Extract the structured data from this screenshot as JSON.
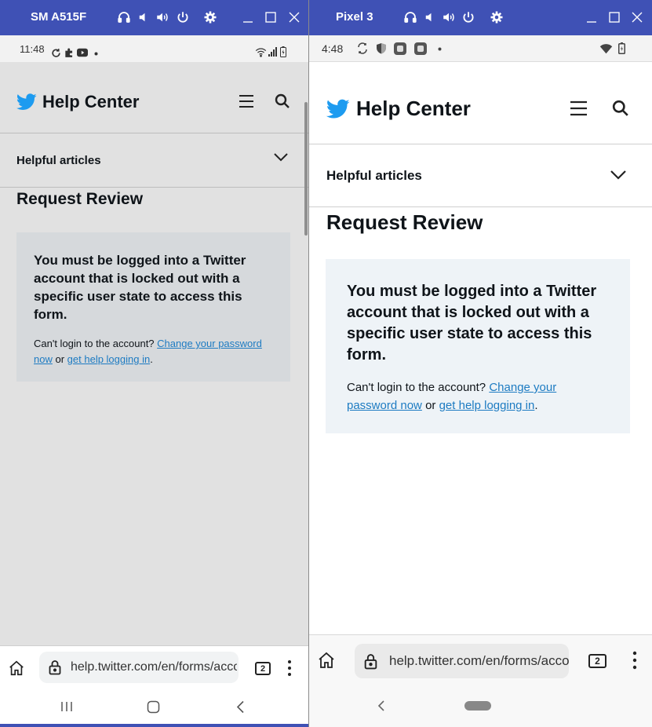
{
  "left_device": {
    "window_title": "SM A515F",
    "status_time": "11:48",
    "brand_name": "Help Center",
    "accordion_label": "Helpful articles",
    "page_title": "Request Review",
    "notice_message": "You must be logged into a Twitter account that is locked out with a specific user state to access this form.",
    "help_prefix": "Can't login to the account?",
    "link_change_password": "Change your password now",
    "help_or": "or",
    "link_help_logging_in": "get help logging in",
    "help_suffix": ".",
    "url": "help.twitter.com/en/forms/account-access",
    "tab_count": "2"
  },
  "right_device": {
    "window_title": "Pixel 3",
    "status_time": "4:48",
    "brand_name": "Help Center",
    "accordion_label": "Helpful articles",
    "page_title": "Request Review",
    "notice_message": "You must be logged into a Twitter account that is locked out with a specific user state to access this form.",
    "help_prefix": "Can't login to the account?",
    "link_change_password": "Change your password now",
    "help_or": "or",
    "link_help_logging_in": "get help logging in",
    "help_suffix": ".",
    "url": "help.twitter.com/en/forms/account-access",
    "tab_count": "2"
  },
  "colors": {
    "titlebar": "#3f51b5",
    "twitter_blue": "#1d9bf0",
    "link": "#1d7bc2",
    "notice_bg_left": "#d6d9dc",
    "notice_bg_right": "#eef3f7"
  },
  "icons": {
    "titlebar": [
      "headphones-icon",
      "volume-down-icon",
      "volume-up-icon",
      "power-icon",
      "settings-icon",
      "minimize-icon",
      "maximize-icon",
      "close-icon"
    ],
    "browser": [
      "home-icon",
      "lock-icon",
      "tabs-icon",
      "more-icon"
    ]
  }
}
